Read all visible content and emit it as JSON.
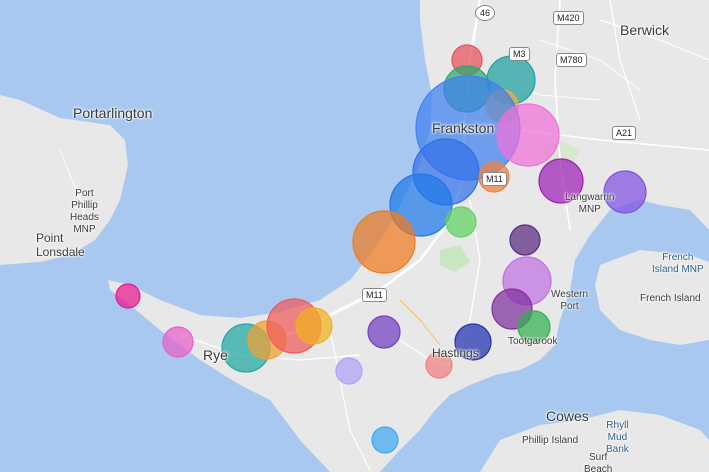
{
  "map": {
    "colors": {
      "water": "#a8c8f0",
      "land": "#e8e8e8",
      "road": "#ffffff",
      "park": "#c8e6c0"
    },
    "places": [
      {
        "id": "berwick",
        "name": "Berwick"
      },
      {
        "id": "portarlington",
        "name": "Portarlington"
      },
      {
        "id": "frankston",
        "name": "Frankston"
      },
      {
        "id": "port-phillip-heads",
        "name": "Port\nPhillip\nHeads\nMNP"
      },
      {
        "id": "point-lonsdale",
        "name": "Point\nLonsdale"
      },
      {
        "id": "langwarrin",
        "name": "Langwarrin\nMNP"
      },
      {
        "id": "french-island-mnp",
        "name": "French\nIsland MNP"
      },
      {
        "id": "french-island",
        "name": "French Island"
      },
      {
        "id": "western-port",
        "name": "Western\nPort"
      },
      {
        "id": "tootgarook",
        "name": "Tootgarook"
      },
      {
        "id": "rye",
        "name": "Rye"
      },
      {
        "id": "hastings",
        "name": "Hastings"
      },
      {
        "id": "cowes",
        "name": "Cowes"
      },
      {
        "id": "rhyll-mud-bank",
        "name": "Rhyll\nMud\nBank"
      },
      {
        "id": "phillip-island",
        "name": "Phillip Island"
      },
      {
        "id": "surf-beach",
        "name": "Surf\nBeach"
      }
    ],
    "road_shields": [
      {
        "id": "r46",
        "label": "46"
      },
      {
        "id": "m420",
        "label": "M420"
      },
      {
        "id": "m3",
        "label": "M3"
      },
      {
        "id": "m780",
        "label": "M780"
      },
      {
        "id": "a21",
        "label": "A21"
      },
      {
        "id": "m11a",
        "label": "M11"
      },
      {
        "id": "m11b",
        "label": "M11"
      }
    ],
    "markers": [
      {
        "id": "m1",
        "color": "#e8505a"
      },
      {
        "id": "m2",
        "color": "#2aa870"
      },
      {
        "id": "m3",
        "color": "#20a0a0"
      },
      {
        "id": "m4",
        "color": "#f0b040"
      },
      {
        "id": "m5",
        "color": "#4080f0"
      },
      {
        "id": "m6",
        "color": "#f070d8"
      },
      {
        "id": "m7",
        "color": "#3070e8"
      },
      {
        "id": "m8",
        "color": "#f08040"
      },
      {
        "id": "m9",
        "color": "#1e78e8"
      },
      {
        "id": "m10",
        "color": "#a020b8"
      },
      {
        "id": "m11",
        "color": "#8050e0"
      },
      {
        "id": "m12",
        "color": "#f07a20"
      },
      {
        "id": "m13",
        "color": "#60d060"
      },
      {
        "id": "m14",
        "color": "#5a2a80"
      },
      {
        "id": "m15",
        "color": "#c070e0"
      },
      {
        "id": "m16",
        "color": "#8030a0"
      },
      {
        "id": "m17",
        "color": "#30b050"
      },
      {
        "id": "m18",
        "color": "#e81890"
      },
      {
        "id": "m19",
        "color": "#e860c8"
      },
      {
        "id": "m20",
        "color": "#20a8a0"
      },
      {
        "id": "m21",
        "color": "#f0a030"
      },
      {
        "id": "m22",
        "color": "#f05a5a"
      },
      {
        "id": "m23",
        "color": "#f0b020"
      },
      {
        "id": "m24",
        "color": "#7040c0"
      },
      {
        "id": "m25",
        "color": "#b0a0f8"
      },
      {
        "id": "m26",
        "color": "#f08080"
      },
      {
        "id": "m27",
        "color": "#2030b0"
      },
      {
        "id": "m28",
        "color": "#40a8f0"
      }
    ]
  }
}
